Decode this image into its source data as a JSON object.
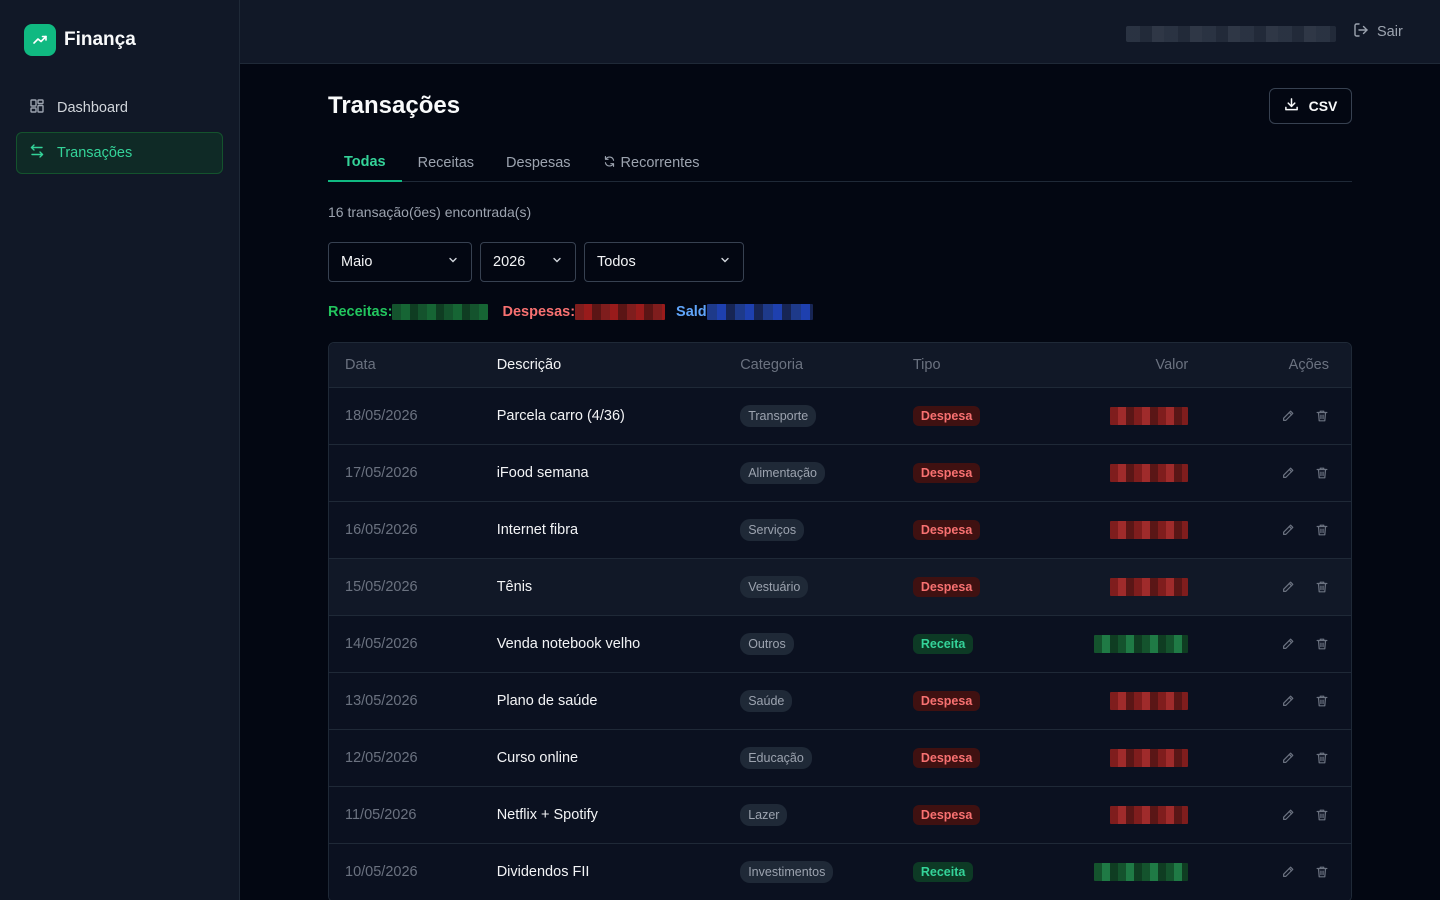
{
  "brand": {
    "name": "Finança",
    "icon": "trending-up-icon"
  },
  "sidebar": {
    "items": [
      {
        "label": "Dashboard",
        "icon": "dashboard-grid-icon",
        "active": false
      },
      {
        "label": "Transações",
        "icon": "transfer-arrows-icon",
        "active": true
      }
    ]
  },
  "topbar": {
    "signout_label": "Sair",
    "signout_icon": "logout-icon"
  },
  "page": {
    "title": "Transações",
    "csv_label": "CSV",
    "csv_icon": "download-icon"
  },
  "tabs": [
    {
      "label": "Todas",
      "active": true
    },
    {
      "label": "Receitas",
      "active": false
    },
    {
      "label": "Despesas",
      "active": false
    },
    {
      "label": "Recorrentes",
      "active": false,
      "icon": "refresh-icon"
    }
  ],
  "results_text": "16 transação(ões) encontrada(s)",
  "filters": {
    "month": "Maio",
    "year": "2026",
    "type": "Todos"
  },
  "summary": {
    "income_label": "Receitas:",
    "expense_label": "Despesas:",
    "balance_label": "Sald"
  },
  "table": {
    "headers": {
      "date": "Data",
      "description": "Descrição",
      "category": "Categoria",
      "type": "Tipo",
      "value": "Valor",
      "actions": "Ações"
    },
    "rows": [
      {
        "date": "18/05/2026",
        "description": "Parcela carro (4/36)",
        "category": "Transporte",
        "type": "Despesa"
      },
      {
        "date": "17/05/2026",
        "description": "iFood semana",
        "category": "Alimentação",
        "type": "Despesa"
      },
      {
        "date": "16/05/2026",
        "description": "Internet fibra",
        "category": "Serviços",
        "type": "Despesa"
      },
      {
        "date": "15/05/2026",
        "description": "Tênis",
        "category": "Vestuário",
        "type": "Despesa"
      },
      {
        "date": "14/05/2026",
        "description": "Venda notebook velho",
        "category": "Outros",
        "type": "Receita"
      },
      {
        "date": "13/05/2026",
        "description": "Plano de saúde",
        "category": "Saúde",
        "type": "Despesa"
      },
      {
        "date": "12/05/2026",
        "description": "Curso online",
        "category": "Educação",
        "type": "Despesa"
      },
      {
        "date": "11/05/2026",
        "description": "Netflix + Spotify",
        "category": "Lazer",
        "type": "Despesa"
      },
      {
        "date": "10/05/2026",
        "description": "Dividendos FII",
        "category": "Investimentos",
        "type": "Receita"
      }
    ]
  },
  "colors": {
    "accent": "#10b981",
    "income": "#34d399",
    "expense": "#f87171",
    "balance": "#60a5fa"
  }
}
